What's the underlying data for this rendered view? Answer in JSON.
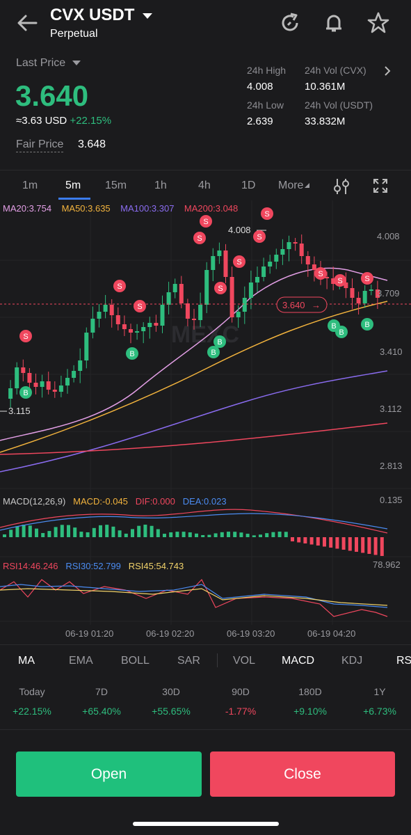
{
  "header": {
    "symbol": "CVX USDT",
    "contract_type": "Perpetual"
  },
  "price": {
    "last_price_label": "Last Price",
    "last_price": "3.640",
    "usd_approx": "≈3.63 USD",
    "change": "+22.15%",
    "fair_price_label": "Fair Price",
    "fair_price": "3.648"
  },
  "stats": {
    "high_label": "24h High",
    "high": "4.008",
    "vol_cvx_label": "24h Vol (CVX)",
    "vol_cvx": "10.361M",
    "low_label": "24h Low",
    "low": "2.639",
    "vol_usdt_label": "24h Vol  (USDT)",
    "vol_usdt": "33.832M"
  },
  "timeframes": [
    "1m",
    "5m",
    "15m",
    "1h",
    "4h",
    "1D",
    "More"
  ],
  "active_timeframe": "5m",
  "ma": {
    "ma20": "MA20:3.754",
    "ma50": "MA50:3.635",
    "ma100": "MA100:3.307",
    "ma200": "MA200:3.048"
  },
  "price_axis": [
    "4.008",
    "3.709",
    "3.410",
    "3.112",
    "2.813"
  ],
  "chart_labels": {
    "high_marker": "4.008",
    "low_marker": "3.115",
    "current_tag": "3.640",
    "watermark": "MEXC"
  },
  "macd": {
    "params": "MACD(12,26,9)",
    "macd": "MACD:-0.045",
    "dif": "DIF:0.000",
    "dea": "DEA:0.023",
    "axis_top": "0.135"
  },
  "rsi": {
    "rsi14": "RSI14:46.246",
    "rsi30": "RSI30:52.799",
    "rsi45": "RSI45:54.743",
    "axis_top": "78.962"
  },
  "times": [
    "06-19 01:20",
    "06-19 02:20",
    "06-19 03:20",
    "06-19 04:20"
  ],
  "indicator_tabs": [
    "MA",
    "EMA",
    "BOLL",
    "SAR",
    "VOL",
    "MACD",
    "KDJ",
    "RS"
  ],
  "active_indicator_tabs": [
    "MA",
    "MACD"
  ],
  "periods": [
    {
      "label": "Today",
      "value": "+22.15%",
      "color": "#2ebd7e"
    },
    {
      "label": "7D",
      "value": "+65.40%",
      "color": "#2ebd7e"
    },
    {
      "label": "30D",
      "value": "+55.65%",
      "color": "#2ebd7e"
    },
    {
      "label": "90D",
      "value": "-1.77%",
      "color": "#f0475e"
    },
    {
      "label": "180D",
      "value": "+9.10%",
      "color": "#2ebd7e"
    },
    {
      "label": "1Y",
      "value": "+6.73%",
      "color": "#2ebd7e"
    }
  ],
  "actions": {
    "open": "Open",
    "close": "Close"
  },
  "colors": {
    "up": "#2ebd7e",
    "down": "#f0475e",
    "bg": "#1b1b1d"
  }
}
